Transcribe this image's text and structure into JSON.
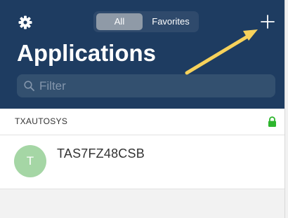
{
  "header": {
    "title": "Applications",
    "settings_icon": "gear-icon",
    "add_icon": "plus-icon",
    "segments": {
      "all_label": "All",
      "favorites_label": "Favorites",
      "selected": "All"
    },
    "search": {
      "placeholder": "Filter",
      "icon": "search-icon"
    }
  },
  "section": {
    "title": "TXAUTOSYS",
    "lock_icon": "lock-icon",
    "lock_color": "#2db52d"
  },
  "apps": [
    {
      "initial": "T",
      "name": "TAS7FZ48CSB",
      "avatar_color": "#a5d6a5"
    }
  ],
  "colors": {
    "header_bg": "#1e3c61",
    "annotation_arrow": "#f7d25b"
  }
}
